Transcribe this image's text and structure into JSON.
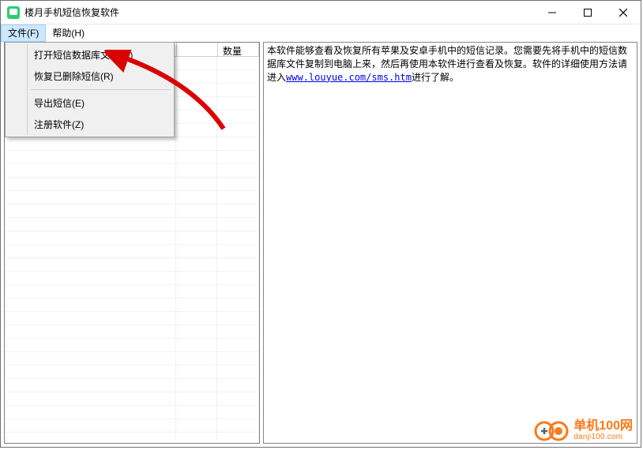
{
  "window": {
    "title": "楼月手机短信恢复软件"
  },
  "menubar": {
    "file": "文件(F)",
    "help": "帮助(H)"
  },
  "dropdown": {
    "open_db": "打开短信数据库文件(O)",
    "recover_deleted": "恢复已删除短信(R)",
    "export_sms": "导出短信(E)",
    "register": "注册软件(Z)"
  },
  "table": {
    "columns": {
      "col0": "",
      "col1": "",
      "col2": "数量"
    }
  },
  "info": {
    "pre_text": "本软件能够查看及恢复所有苹果及安卓手机中的短信记录。您需要先将手机中的短信数据库文件复制到电脑上来，然后再使用本软件进行查看及恢复。软件的详细使用方法请进入",
    "link_text": "www.louyue.com/sms.htm",
    "link_href": "http://www.louyue.com/sms.htm",
    "post_text": "进行了解。"
  },
  "watermark": {
    "main": "单机100网",
    "sub": "danji100.com"
  }
}
